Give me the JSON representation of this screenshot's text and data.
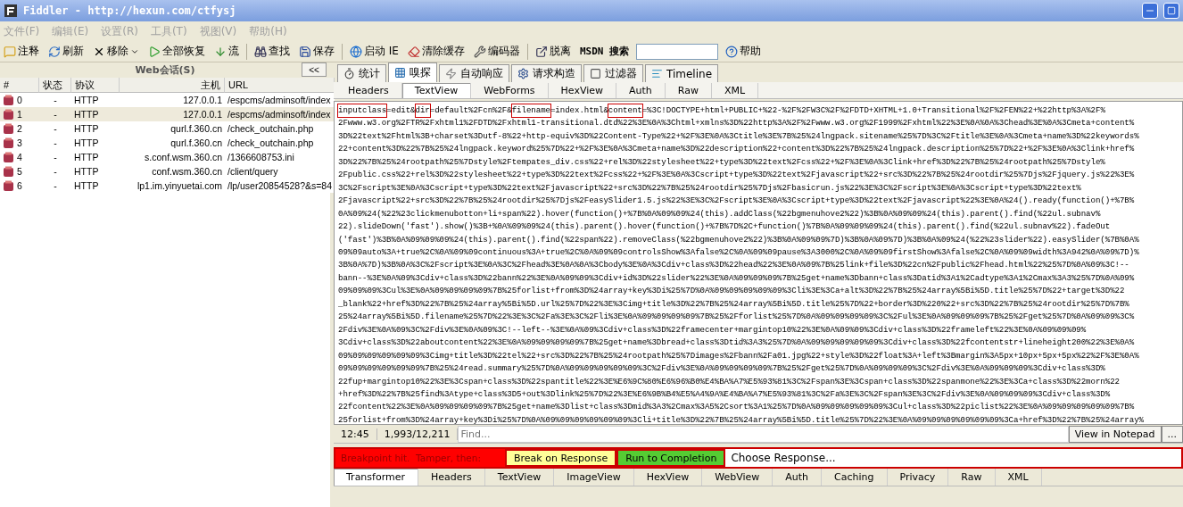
{
  "window": {
    "title": "Fiddler - http://hexun.com/ctfysj"
  },
  "menu": [
    {
      "label": "文件(F)",
      "disabled": true
    },
    {
      "label": "编辑(E)",
      "disabled": true
    },
    {
      "label": "设置(R)",
      "disabled": true
    },
    {
      "label": "工具(T)",
      "disabled": true
    },
    {
      "label": "视图(V)",
      "disabled": true
    },
    {
      "label": "帮助(H)",
      "disabled": true
    }
  ],
  "toolbar": [
    {
      "kind": "comment",
      "label": "注释"
    },
    {
      "kind": "refresh",
      "label": "刷新"
    },
    {
      "kind": "remove",
      "label": "移除",
      "dropdown": true
    },
    {
      "kind": "resume",
      "label": "全部恢复"
    },
    {
      "kind": "stream",
      "label": "流"
    },
    {
      "kind": "sep"
    },
    {
      "kind": "find",
      "label": "查找"
    },
    {
      "kind": "save",
      "label": "保存"
    },
    {
      "kind": "sep"
    },
    {
      "kind": "ie",
      "label": "启动 IE"
    },
    {
      "kind": "clear",
      "label": "清除缓存"
    },
    {
      "kind": "encoder",
      "label": "编码器"
    },
    {
      "kind": "sep"
    },
    {
      "kind": "detach",
      "label": "脱离"
    },
    {
      "kind": "search",
      "label": "MSDN 搜索"
    },
    {
      "kind": "help",
      "label": "帮助"
    }
  ],
  "sessions": {
    "title": "Web会话(S)",
    "collapse": "<<",
    "columns": [
      "#",
      "状态",
      "协议",
      "主机",
      "URL"
    ],
    "rows": [
      {
        "num": "0",
        "status": "-",
        "protocol": "HTTP",
        "host": "127.0.0.1",
        "url": "/espcms/adminsoft/index",
        "selected": false
      },
      {
        "num": "1",
        "status": "-",
        "protocol": "HTTP",
        "host": "127.0.0.1",
        "url": "/espcms/adminsoft/index",
        "selected": true
      },
      {
        "num": "2",
        "status": "-",
        "protocol": "HTTP",
        "host": "qurl.f.360.cn",
        "url": "/check_outchain.php",
        "selected": false
      },
      {
        "num": "3",
        "status": "-",
        "protocol": "HTTP",
        "host": "qurl.f.360.cn",
        "url": "/check_outchain.php",
        "selected": false
      },
      {
        "num": "4",
        "status": "-",
        "protocol": "HTTP",
        "host": "s.conf.wsm.360.cn",
        "url": "/1366608753.ini",
        "selected": false
      },
      {
        "num": "5",
        "status": "-",
        "protocol": "HTTP",
        "host": "conf.wsm.360.cn",
        "url": "/client/query",
        "selected": false
      },
      {
        "num": "6",
        "status": "-",
        "protocol": "HTTP",
        "host": "lp1.im.yinyuetai.com",
        "url": "/lp/user20854528?&s=84",
        "selected": false
      }
    ]
  },
  "main_tabs": [
    {
      "kind": "stats",
      "label": "统计",
      "selected": false
    },
    {
      "kind": "inspect",
      "label": "嗅探",
      "selected": true
    },
    {
      "kind": "auto",
      "label": "自动响应",
      "selected": false
    },
    {
      "kind": "compose",
      "label": "请求构造",
      "selected": false
    },
    {
      "kind": "filter",
      "label": "过滤器",
      "selected": false
    },
    {
      "kind": "timeline",
      "label": "Timeline",
      "selected": false
    }
  ],
  "request_tabs": [
    {
      "label": "Headers",
      "selected": false
    },
    {
      "label": "TextView",
      "selected": true
    },
    {
      "label": "WebForms",
      "selected": false
    },
    {
      "label": "HexView",
      "selected": false
    },
    {
      "label": "Auth",
      "selected": false
    },
    {
      "label": "Raw",
      "selected": false
    },
    {
      "label": "XML",
      "selected": false
    }
  ],
  "first_line": [
    {
      "text": "inputclass",
      "boxed": true
    },
    {
      "text": "=edit&",
      "boxed": false
    },
    {
      "text": "dir",
      "boxed": true
    },
    {
      "text": "=default%2Fcn%2F&",
      "boxed": false
    },
    {
      "text": "filename",
      "boxed": true
    },
    {
      "text": "=index.html&",
      "boxed": false
    },
    {
      "text": "content",
      "boxed": true
    },
    {
      "text": "=%3C!DOCTYPE+html+PUBLIC+%22-%2F%2FW3C%2F%2FDTD+XHTML+1.0+Transitional%2F%2FEN%22+%22http%3A%2F%",
      "boxed": false
    }
  ],
  "lines": [
    "2Fwww.w3.org%2FTR%2Fxhtml1%2FDTD%2Fxhtml1-transitional.dtd%22%3E%0A%3Chtml+xmlns%3D%22http%3A%2F%2Fwww.w3.org%2F1999%2Fxhtml%22%3E%0A%0A%3Chead%3E%0A%3Cmeta+content%",
    "3D%22text%2Fhtml%3B+charset%3Dutf-8%22+http-equiv%3D%22Content-Type%22+%2F%3E%0A%3Ctitle%3E%7B%25%24lngpack.sitename%25%7D%3C%2Ftitle%3E%0A%3Cmeta+name%3D%22keywords%",
    "22+content%3D%22%7B%25%24lngpack.keyword%25%7D%22+%2F%3E%0A%3Cmeta+name%3D%22description%22+content%3D%22%7B%25%24lngpack.description%25%7D%22+%2F%3E%0A%3Clink+href%",
    "3D%22%7B%25%24rootpath%25%7Dstyle%2Ftempates_div.css%22+rel%3D%22stylesheet%22+type%3D%22text%2Fcss%22+%2F%3E%0A%3Clink+href%3D%22%7B%25%24rootpath%25%7Dstyle%",
    "2Fpublic.css%22+rel%3D%22stylesheet%22+type%3D%22text%2Fcss%22+%2F%3E%0A%3Cscript+type%3D%22text%2Fjavascript%22+src%3D%22%7B%25%24rootdir%25%7Djs%2Fjquery.js%22%3E%",
    "3C%2Fscript%3E%0A%3Cscript+type%3D%22text%2Fjavascript%22+src%3D%22%7B%25%24rootdir%25%7Djs%2Fbasicrun.js%22%3E%3C%2Fscript%3E%0A%3Cscript+type%3D%22text%",
    "2Fjavascript%22+src%3D%22%7B%25%24rootdir%25%7Djs%2FeasySlider1.5.js%22%3E%3C%2Fscript%3E%0A%3Cscript+type%3D%22text%2Fjavascript%22%3E%0A%24().ready(function()+%7B%",
    "0A%09%24(%22%23clickmenubotton+li+span%22).hover(function()+%7B%0A%09%09%24(this).addClass(%22bgmenuhove2%22)%3B%0A%09%09%24(this).parent().find(%22ul.subnav%",
    "22).slideDown('fast').show()%3B+%0A%09%09%24(this).parent().hover(function()+%7B%7D%2C+function()%7B%0A%09%09%09%24(this).parent().find(%22ul.subnav%22).fadeOut",
    "('fast')%3B%0A%09%09%09%24(this).parent().find(%22span%22).removeClass(%22bgmenuhove2%22)%3B%0A%09%09%7D)%3B%0A%09%7D)%3B%0A%09%24(%22%23slider%22).easySlider(%7B%0A%",
    "09%09auto%3A+true%2C%0A%09%09continuous%3A+true%2C%0A%09%09controlsShow%3Afalse%2C%0A%09%09pause%3A3000%2C%0A%09%09firstShow%3Afalse%2C%0A%09%09width%3A942%0A%09%7D)%",
    "3B%0A%7D)%3B%0A%3C%2Fscript%3E%0A%3C%2Fhead%3E%0A%0A%3Cbody%3E%0A%3Cdiv+class%3D%22head%22%3E%0A%09%7B%25link+file%3D%22cn%2Fpublic%2Fhead.html%22%25%7D%0A%09%3C!--",
    "bann--%3E%0A%09%3Cdiv+class%3D%22bann%22%3E%0A%09%09%3Cdiv+id%3D%22slider%22%3E%0A%09%09%09%7B%25get+name%3Dbann+class%3Datid%3A1%2Cadtype%3A1%2Cmax%3A3%25%7D%0A%09%",
    "09%09%09%3Cul%3E%0A%09%09%09%09%7B%25forlist+from%3D%24array+key%3Di%25%7D%0A%09%09%09%09%09%3Cli%3E%3Ca+alt%3D%22%7B%25%24array%5Bi%5D.title%25%7D%22+target%3D%22",
    "_blank%22+href%3D%22%7B%25%24array%5Bi%5D.url%25%7D%22%3E%3Cimg+title%3D%22%7B%25%24array%5Bi%5D.title%25%7D%22+border%3D%220%22+src%3D%22%7B%25%24rootdir%25%7D%7B%",
    "25%24array%5Bi%5D.filename%25%7D%22%3E%3C%2Fa%3E%3C%2Fli%3E%0A%09%09%09%09%7B%25%2Fforlist%25%7D%0A%09%09%09%09%3C%2Ful%3E%0A%09%09%09%7B%25%2Fget%25%7D%0A%09%09%3C%",
    "2Fdiv%3E%0A%09%3C%2Fdiv%3E%0A%09%3C!--left--%3E%0A%09%3Cdiv+class%3D%22framecenter+margintop10%22%3E%0A%09%09%3Cdiv+class%3D%22frameleft%22%3E%0A%09%09%09%",
    "3Cdiv+class%3D%22aboutcontent%22%3E%0A%09%09%09%09%7B%25get+name%3Dbread+class%3Dtid%3A3%25%7D%0A%09%09%09%09%09%3Cdiv+class%3D%22fcontentstr+lineheight200%22%3E%0A%",
    "09%09%09%09%09%09%3Cimg+title%3D%22tel%22+src%3D%22%7B%25%24rootpath%25%7Dimages%2Fbann%2Fa01.jpg%22+style%3D%22float%3A+left%3Bmargin%3A5px+10px+5px+5px%22%2F%3E%0A%",
    "09%09%09%09%09%09%7B%25%24read.summary%25%7D%0A%09%09%09%09%09%3C%2Fdiv%3E%0A%09%09%09%09%7B%25%2Fget%25%7D%0A%09%09%09%3C%2Fdiv%3E%0A%09%09%09%3Cdiv+class%3D%",
    "22fup+margintop10%22%3E%3Cspan+class%3D%22spantitle%22%3E%E6%9C%80%E6%96%B0%E4%BA%A7%E5%93%81%3C%2Fspan%3E%3Cspan+class%3D%22spanmone%22%3E%3Ca+class%3D%22morn%22",
    "+href%3D%22%7B%25find%3Atype+class%3D5+out%3Dlink%25%7D%22%3E%E6%9B%B4%E5%A4%9A%E4%BA%A7%E5%93%81%3C%2Fa%3E%3C%2Fspan%3E%3C%2Fdiv%3E%0A%09%09%09%3Cdiv+class%3D%",
    "22fcontent%22%3E%0A%09%09%09%09%7B%25get+name%3Dlist+class%3Dmid%3A3%2Cmax%3A5%2Csort%3A1%25%7D%0A%09%09%09%09%09%3Cul+class%3D%22piclist%22%3E%0A%09%09%09%09%09%7B%",
    "25forlist+from%3D%24array+key%3Di%25%7D%0A%09%09%09%09%09%09%3Cli+title%3D%22%7B%25%24array%5Bi%5D.title%25%7D%22%3E%0A%09%09%09%09%09%09%3Ca+href%3D%22%7B%25%24array%"
  ],
  "status": {
    "position": "12:45",
    "count": "1,993/12,211",
    "find_placeholder": "Find...",
    "notepad": "View in Notepad",
    "more": "..."
  },
  "breakpoint": {
    "message": "Breakpoint hit.  Tamper, then:",
    "break_button": "Break on Response",
    "run_button": "Run to Completion",
    "choose": "Choose Response..."
  },
  "response_tabs": [
    {
      "label": "Transformer",
      "selected": true
    },
    {
      "label": "Headers",
      "selected": false
    },
    {
      "label": "TextView",
      "selected": false
    },
    {
      "label": "ImageView",
      "selected": false
    },
    {
      "label": "HexView",
      "selected": false
    },
    {
      "label": "WebView",
      "selected": false
    },
    {
      "label": "Auth",
      "selected": false
    },
    {
      "label": "Caching",
      "selected": false
    },
    {
      "label": "Privacy",
      "selected": false
    },
    {
      "label": "Raw",
      "selected": false
    },
    {
      "label": "XML",
      "selected": false
    }
  ]
}
